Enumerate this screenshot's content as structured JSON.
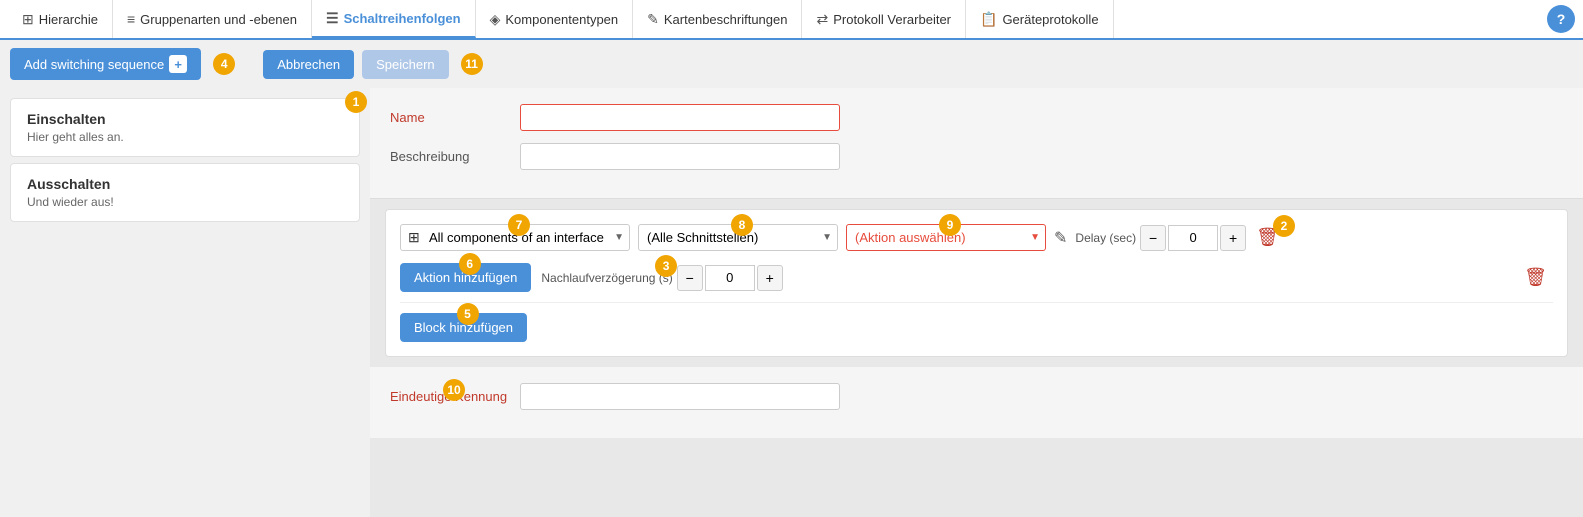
{
  "nav": {
    "tabs": [
      {
        "id": "hierarchie",
        "label": "Hierarchie",
        "icon": "⊞",
        "active": false
      },
      {
        "id": "gruppenarten",
        "label": "Gruppenarten und -ebenen",
        "icon": "≡",
        "active": false
      },
      {
        "id": "schaltreihenfolgen",
        "label": "Schaltreihenfolgen",
        "icon": "☰",
        "active": true
      },
      {
        "id": "komponententypen",
        "label": "Komponententypen",
        "icon": "◈",
        "active": false
      },
      {
        "id": "kartenbeschriftungen",
        "label": "Kartenbeschriftungen",
        "icon": "✎",
        "active": false
      },
      {
        "id": "protokoll",
        "label": "Protokoll Verarbeiter",
        "icon": "⇄",
        "active": false
      },
      {
        "id": "geraeteprotokolle",
        "label": "Geräteprotokolle",
        "icon": "📋",
        "active": false
      }
    ],
    "help_label": "?"
  },
  "toolbar": {
    "add_btn_label": "Add switching sequence",
    "add_btn_badge": "4",
    "cancel_label": "Abbrechen",
    "save_label": "Speichern",
    "save_badge": "11"
  },
  "sidebar": {
    "items": [
      {
        "id": "einschalten",
        "title": "Einschalten",
        "subtitle": "Hier geht alles an.",
        "badge": "1"
      },
      {
        "id": "ausschalten",
        "title": "Ausschalten",
        "subtitle": "Und wieder aus!"
      }
    ]
  },
  "form": {
    "name_label": "Name",
    "name_placeholder": "",
    "name_value": "",
    "beschreibung_label": "Beschreibung",
    "beschreibung_value": ""
  },
  "block": {
    "component_dropdown_label": "All components of an interface",
    "component_dropdown_badge": "7",
    "interface_dropdown_label": "(Alle Schnittstellen)",
    "interface_dropdown_badge": "8",
    "action_dropdown_label": "(Aktion auswählen)",
    "action_dropdown_badge": "9",
    "delay_sec_label": "Delay (sec)",
    "delay_sec_badge": "2",
    "delay_sec_value": "0",
    "aktion_hinzufuegen_label": "Aktion hinzufügen",
    "aktion_hinzufuegen_badge": "6",
    "nachlaufverzoegerung_label": "Nachlaufverzögerung (s)",
    "nachlaufverzoegerung_badge": "3",
    "nachlaufverzoegerung_value": "0",
    "block_hinzufuegen_label": "Block hinzufügen",
    "block_hinzufuegen_badge": "5"
  },
  "eindeutig": {
    "label": "Eindeutige Kennung",
    "badge": "10",
    "value": ""
  },
  "badges": {
    "color": "#f0a500"
  }
}
